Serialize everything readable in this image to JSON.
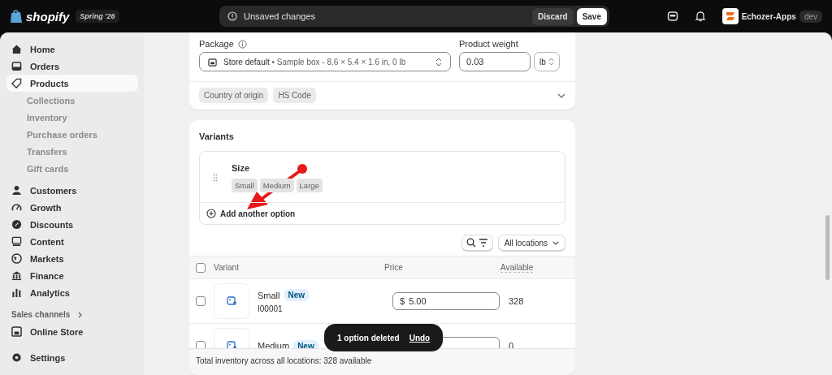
{
  "topbar": {
    "brand": "shopify",
    "edition": "Spring '26",
    "notice": "Unsaved changes",
    "discard": "Discard",
    "save": "Save",
    "store": "Echozer-Apps",
    "store_badge": "dev"
  },
  "sidebar": {
    "items": [
      {
        "label": "Home",
        "kind": "main",
        "selected": false
      },
      {
        "label": "Orders",
        "kind": "main",
        "selected": false
      },
      {
        "label": "Products",
        "kind": "main",
        "selected": true
      },
      {
        "label": "Collections",
        "kind": "sub",
        "selected": false
      },
      {
        "label": "Inventory",
        "kind": "sub",
        "selected": false
      },
      {
        "label": "Purchase orders",
        "kind": "sub",
        "selected": false
      },
      {
        "label": "Transfers",
        "kind": "sub",
        "selected": false
      },
      {
        "label": "Gift cards",
        "kind": "sub",
        "selected": false
      },
      {
        "label": "Customers",
        "kind": "main",
        "selected": false
      },
      {
        "label": "Growth",
        "kind": "main",
        "selected": false
      },
      {
        "label": "Discounts",
        "kind": "main",
        "selected": false
      },
      {
        "label": "Content",
        "kind": "main",
        "selected": false
      },
      {
        "label": "Markets",
        "kind": "main",
        "selected": false
      },
      {
        "label": "Finance",
        "kind": "main",
        "selected": false
      },
      {
        "label": "Analytics",
        "kind": "main",
        "selected": false
      }
    ],
    "channels_heading": "Sales channels",
    "channels": [
      {
        "label": "Online Store",
        "selected": false
      }
    ],
    "settings": "Settings"
  },
  "shipping": {
    "package_label": "Package",
    "package_name": "Store default",
    "package_detail": "• Sample box - 8.6 × 5.4 × 1.6 in, 0 lb",
    "weight_label": "Product weight",
    "weight": "0.03",
    "unit": "lb",
    "chips": [
      "Country of origin",
      "HS Code"
    ]
  },
  "variants": {
    "title": "Variants",
    "option_name": "Size",
    "option_values": [
      "Small",
      "Medium",
      "Large"
    ],
    "add_option": "Add another option",
    "location": "All locations",
    "select_all_checked": false,
    "columns": [
      "Variant",
      "Price",
      "Available"
    ],
    "rows": [
      {
        "name": "Small",
        "badge": "New",
        "sku": "I00001",
        "currency": "$",
        "price": "5.00",
        "available": "328",
        "checked": false
      },
      {
        "name": "Medium",
        "badge": "New",
        "available": "0",
        "checked": false
      }
    ],
    "footer": "Total inventory across all locations: 328 available"
  },
  "toast": {
    "message": "1 option deleted",
    "action": "Undo"
  }
}
